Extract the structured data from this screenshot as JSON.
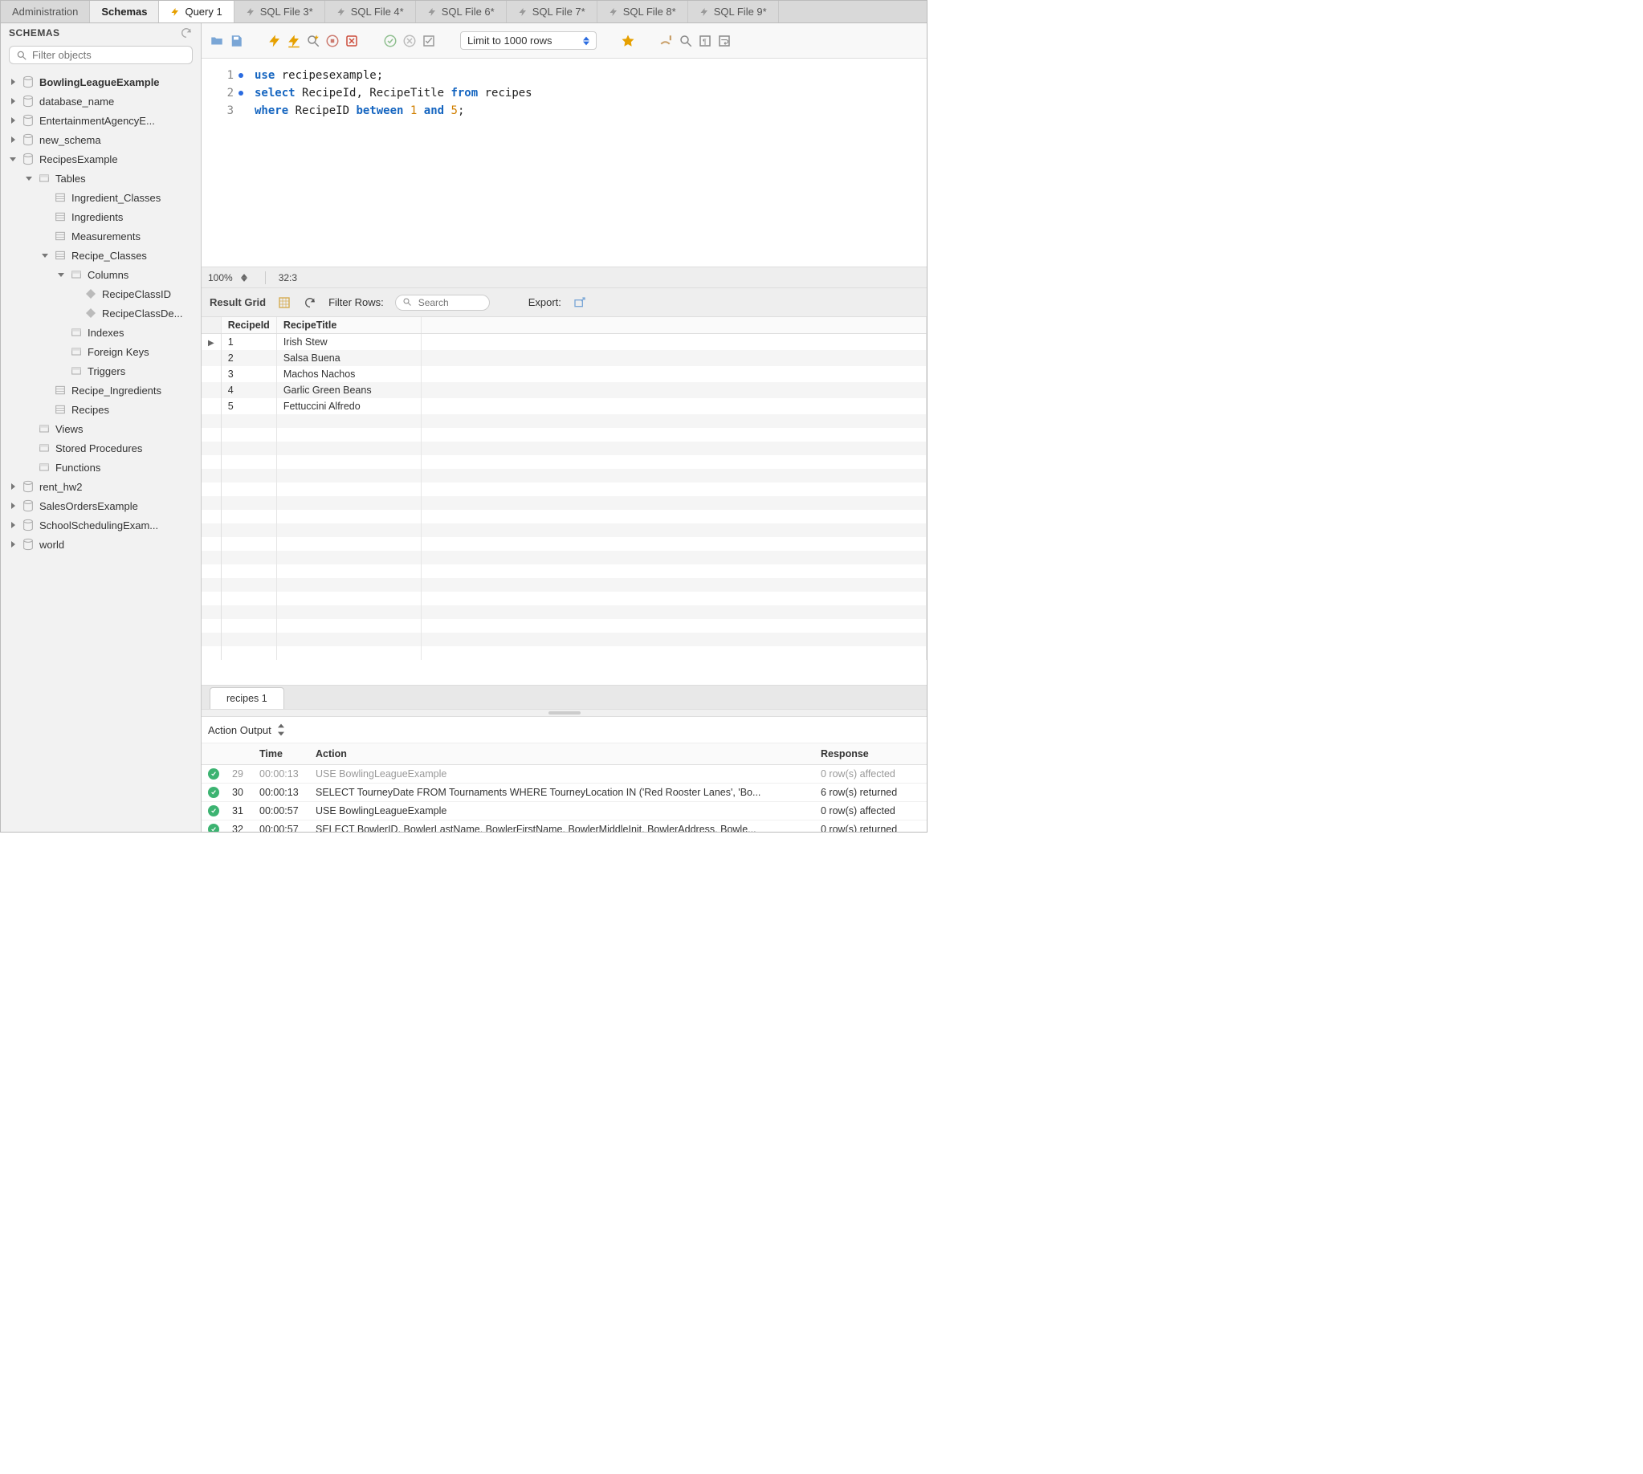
{
  "tabs": {
    "admin": "Administration",
    "schemas": "Schemas",
    "query": "Query 1",
    "files": [
      "SQL File 3*",
      "SQL File 4*",
      "SQL File 6*",
      "SQL File 7*",
      "SQL File 8*",
      "SQL File 9*"
    ]
  },
  "sidebar": {
    "header": "SCHEMAS",
    "filter_placeholder": "Filter objects",
    "schemas": [
      {
        "name": "BowlingLeagueExample",
        "bold": true,
        "expanded": false
      },
      {
        "name": "database_name",
        "expanded": false
      },
      {
        "name": "EntertainmentAgencyE...",
        "expanded": false
      },
      {
        "name": "new_schema",
        "expanded": false
      },
      {
        "name": "RecipesExample",
        "expanded": true,
        "children": [
          {
            "name": "Tables",
            "type": "group",
            "expanded": true,
            "children": [
              {
                "name": "Ingredient_Classes",
                "type": "table"
              },
              {
                "name": "Ingredients",
                "type": "table"
              },
              {
                "name": "Measurements",
                "type": "table"
              },
              {
                "name": "Recipe_Classes",
                "type": "table",
                "expanded": true,
                "children": [
                  {
                    "name": "Columns",
                    "type": "folder",
                    "expanded": true,
                    "children": [
                      {
                        "name": "RecipeClassID",
                        "type": "column"
                      },
                      {
                        "name": "RecipeClassDe...",
                        "type": "column"
                      }
                    ]
                  },
                  {
                    "name": "Indexes",
                    "type": "folder"
                  },
                  {
                    "name": "Foreign Keys",
                    "type": "folder"
                  },
                  {
                    "name": "Triggers",
                    "type": "folder"
                  }
                ]
              },
              {
                "name": "Recipe_Ingredients",
                "type": "table"
              },
              {
                "name": "Recipes",
                "type": "table"
              }
            ]
          },
          {
            "name": "Views",
            "type": "group"
          },
          {
            "name": "Stored Procedures",
            "type": "group"
          },
          {
            "name": "Functions",
            "type": "group"
          }
        ]
      },
      {
        "name": "rent_hw2",
        "expanded": false
      },
      {
        "name": "SalesOrdersExample",
        "expanded": false
      },
      {
        "name": "SchoolSchedulingExam...",
        "expanded": false
      },
      {
        "name": "world",
        "expanded": false
      }
    ]
  },
  "toolbar": {
    "limit": "Limit to 1000 rows"
  },
  "editor": {
    "lines": [
      {
        "n": "1",
        "dot": true,
        "tokens": [
          [
            "kw",
            "use"
          ],
          [
            "sp",
            " "
          ],
          [
            "id",
            "recipesexample;"
          ]
        ]
      },
      {
        "n": "2",
        "dot": true,
        "tokens": [
          [
            "kw",
            "select"
          ],
          [
            "sp",
            " "
          ],
          [
            "id",
            "RecipeId, RecipeTitle "
          ],
          [
            "kw",
            "from"
          ],
          [
            "sp",
            " "
          ],
          [
            "id",
            "recipes"
          ]
        ]
      },
      {
        "n": "3",
        "dot": false,
        "tokens": [
          [
            "kw",
            "where"
          ],
          [
            "sp",
            " "
          ],
          [
            "id",
            "RecipeID "
          ],
          [
            "kw",
            "between"
          ],
          [
            "sp",
            " "
          ],
          [
            "num",
            "1"
          ],
          [
            "sp",
            " "
          ],
          [
            "kw",
            "and"
          ],
          [
            "sp",
            " "
          ],
          [
            "num",
            "5"
          ],
          [
            "id",
            ";"
          ]
        ]
      }
    ],
    "zoom": "100%",
    "cursor": "32:3"
  },
  "result": {
    "label": "Result Grid",
    "filter_label": "Filter Rows:",
    "filter_placeholder": "Search",
    "export_label": "Export:",
    "columns": [
      "RecipeId",
      "RecipeTitle"
    ],
    "rows": [
      {
        "id": "1",
        "title": "Irish Stew",
        "ptr": true
      },
      {
        "id": "2",
        "title": "Salsa Buena"
      },
      {
        "id": "3",
        "title": "Machos Nachos"
      },
      {
        "id": "4",
        "title": "Garlic Green Beans"
      },
      {
        "id": "5",
        "title": "Fettuccini Alfredo"
      }
    ],
    "tab": "recipes 1"
  },
  "action_output": {
    "label": "Action Output",
    "columns": [
      "",
      "",
      "Time",
      "Action",
      "Response"
    ],
    "rows": [
      {
        "ok": true,
        "n": "29",
        "time": "00:00:13",
        "action": "USE BowlingLeagueExample",
        "response": "0 row(s) affected",
        "dim": true
      },
      {
        "ok": true,
        "n": "30",
        "time": "00:00:13",
        "action": "SELECT TourneyDate FROM Tournaments WHERE TourneyLocation IN ('Red Rooster Lanes', 'Bo...",
        "response": "6 row(s) returned"
      },
      {
        "ok": true,
        "n": "31",
        "time": "00:00:57",
        "action": "USE BowlingLeagueExample",
        "response": "0 row(s) affected"
      },
      {
        "ok": true,
        "n": "32",
        "time": "00:00:57",
        "action": "SELECT BowlerID, BowlerLastName, BowlerFirstName, BowlerMiddleInit, BowlerAddress, Bowle...",
        "response": "0 row(s) returned"
      }
    ]
  }
}
